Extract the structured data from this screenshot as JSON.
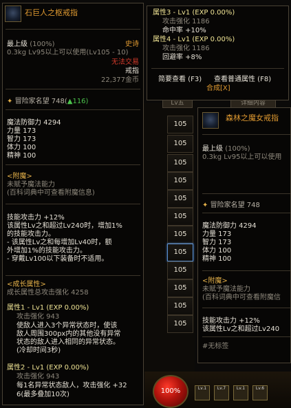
{
  "left_tooltip": {
    "title": "石巨人之枢戒指",
    "grade": "最上级",
    "grade_pct": "(100%)",
    "rarity": "史诗",
    "weight_level": "0.3kg  Lv95以上可以使用(Lv105 - 10)",
    "no_trade": "无法交易",
    "type": "戒指",
    "price": "22,377金币",
    "reputation_label": "冒险家名望",
    "reputation_value": "748(",
    "reputation_up": "▲116)",
    "stats": [
      "魔法防御力 4294",
      "力量 173",
      "智力 173",
      "体力 100",
      "精神 100"
    ],
    "enchant_header": "<附魔>",
    "enchant_line1": "未赋予魔法能力",
    "enchant_line2": "(百科词典中可查看附魔信息)",
    "skill_lines": [
      "技能攻击力 +12%",
      "该属性Lv之和超过Lv240时，增加1%",
      "的技能攻击力。",
      "- 该属性Lv之和每增加Lv40时，额",
      "外增加1%的技能攻击力。",
      "- 穿戴Lv100以下装备时不适用。"
    ],
    "growth_header": "<成长属性>",
    "growth_total": "成长属性总攻击强化 4258",
    "attr1_title": "属性1 - Lv1 (EXP 0.00%)",
    "attr1_atk": "攻击强化 943",
    "attr1_desc": [
      "使敌人进入3个异常状态时，使该",
      "敌人周围300px内的其他没有异常",
      "状态的敌人进入相同的异常状态。",
      "(冷却时间3秒)"
    ],
    "attr2_title": "属性2 - Lv1 (EXP 0.00%)",
    "attr2_atk": "攻击强化 943",
    "attr2_desc1": "每1名异常状态敌人，攻击强化 +32",
    "attr2_desc2": "6(最多叠加10次)"
  },
  "top_tooltip": {
    "attr3_title": "属性3 - Lv1 (EXP 0.00%)",
    "attr3_atk": "攻击强化 1186",
    "attr3_bonus": "命中率 +10%",
    "attr4_title": "属性4 - Lv1 (EXP 0.00%)",
    "attr4_atk": "攻击强化 1186",
    "attr4_bonus": "回避率 +8%",
    "link_simple": "简要查看 (F3)",
    "link_normal": "查看普通属性 (F8)",
    "synth": "合成[X]"
  },
  "right_tooltip": {
    "title": "森林之魔女戒指",
    "grade": "最上级",
    "grade_pct": "(100%)",
    "weight_level": "0.3kg    Lv95以上可以使用",
    "reputation_label": "冒险家名望",
    "reputation_value": "748",
    "stats": [
      "魔法防御力 4294",
      "力量 173",
      "智力 173",
      "体力 100",
      "精神 100"
    ],
    "enchant_header": "<附魔>",
    "enchant_line1": "未赋予魔法能力",
    "enchant_line2": "(百科词典中可查看附魔信",
    "skill_line1": "技能攻击力 +12%",
    "skill_line2": "该属性Lv之和超过Lv240",
    "tag": "#无标签"
  },
  "list_cells": [
    "105",
    "105",
    "105",
    "105",
    "105",
    "105",
    "105",
    "105",
    "105",
    "105",
    "105",
    "105"
  ],
  "tabs": {
    "lv_tab": "Lv五",
    "detail_tab": "详细内容"
  },
  "hud": {
    "hp_pct": "100%",
    "slot_labels": [
      "Lv.1",
      "Lv.7",
      "Lv.1",
      "Lv.6"
    ]
  },
  "colors": {
    "gold": "#e6b24a",
    "epic_orange": "#e09a31",
    "red": "#d23a2a",
    "selected_blue": "#5a8fd0"
  }
}
